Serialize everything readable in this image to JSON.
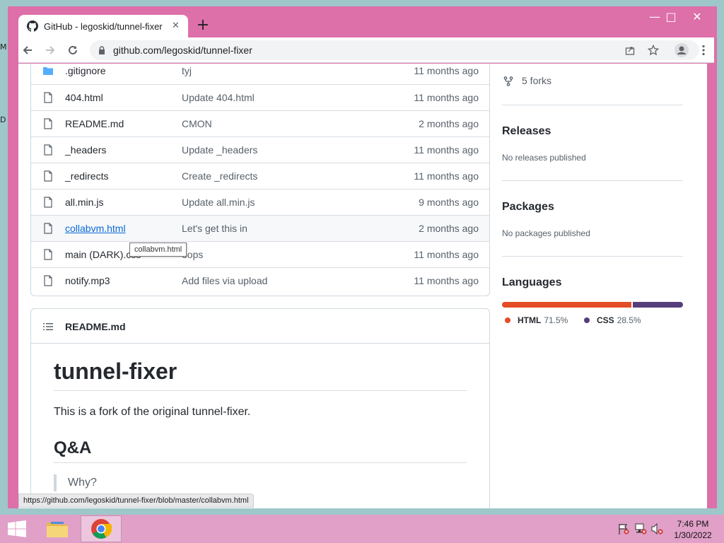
{
  "desktop": {
    "edge_letters": [
      "M",
      "D"
    ]
  },
  "window": {
    "controls": {
      "minimize": "—",
      "maximize": "□",
      "close": "✕"
    }
  },
  "browser": {
    "tab": {
      "title": "GitHub - legoskid/tunnel-fixer",
      "close": "✕"
    },
    "new_tab": "+",
    "url": "github.com/legoskid/tunnel-fixer"
  },
  "files": [
    {
      "name": ".gitignore",
      "type": "folder",
      "message": "tyj",
      "age": "11 months ago"
    },
    {
      "name": "404.html",
      "type": "file",
      "message": "Update 404.html",
      "age": "11 months ago"
    },
    {
      "name": "README.md",
      "type": "file",
      "message": "CMON",
      "age": "2 months ago"
    },
    {
      "name": "_headers",
      "type": "file",
      "message": "Update _headers",
      "age": "11 months ago"
    },
    {
      "name": "_redirects",
      "type": "file",
      "message": "Create _redirects",
      "age": "11 months ago"
    },
    {
      "name": "all.min.js",
      "type": "file",
      "message": "Update all.min.js",
      "age": "9 months ago"
    },
    {
      "name": "collabvm.html",
      "type": "file",
      "message": "Let's get this in",
      "age": "2 months ago",
      "hovered": true
    },
    {
      "name": "main (DARK).css",
      "type": "file",
      "message": "oops",
      "age": "11 months ago"
    },
    {
      "name": "notify.mp3",
      "type": "file",
      "message": "Add files via upload",
      "age": "11 months ago"
    }
  ],
  "tooltip": "collabvm.html",
  "readme": {
    "header": "README.md",
    "h1": "tunnel-fixer",
    "intro": "This is a fork of the original tunnel-fixer.",
    "h2": "Q&A",
    "quote": "Why?"
  },
  "sidebar": {
    "forks": "5 forks",
    "releases": {
      "title": "Releases",
      "text": "No releases published"
    },
    "packages": {
      "title": "Packages",
      "text": "No packages published"
    },
    "languages": {
      "title": "Languages",
      "items": [
        {
          "name": "HTML",
          "percent": "71.5%",
          "value": 71.5,
          "color": "#e34c26"
        },
        {
          "name": "CSS",
          "percent": "28.5%",
          "value": 28.5,
          "color": "#563d7c"
        }
      ]
    }
  },
  "status_url": "https://github.com/legoskid/tunnel-fixer/blob/master/collabvm.html",
  "taskbar": {
    "time": "7:46 PM",
    "date": "1/30/2022"
  },
  "colors": {
    "window_frame": "#dd6fa9",
    "taskbar": "#e0a0c8",
    "link": "#0969da"
  }
}
